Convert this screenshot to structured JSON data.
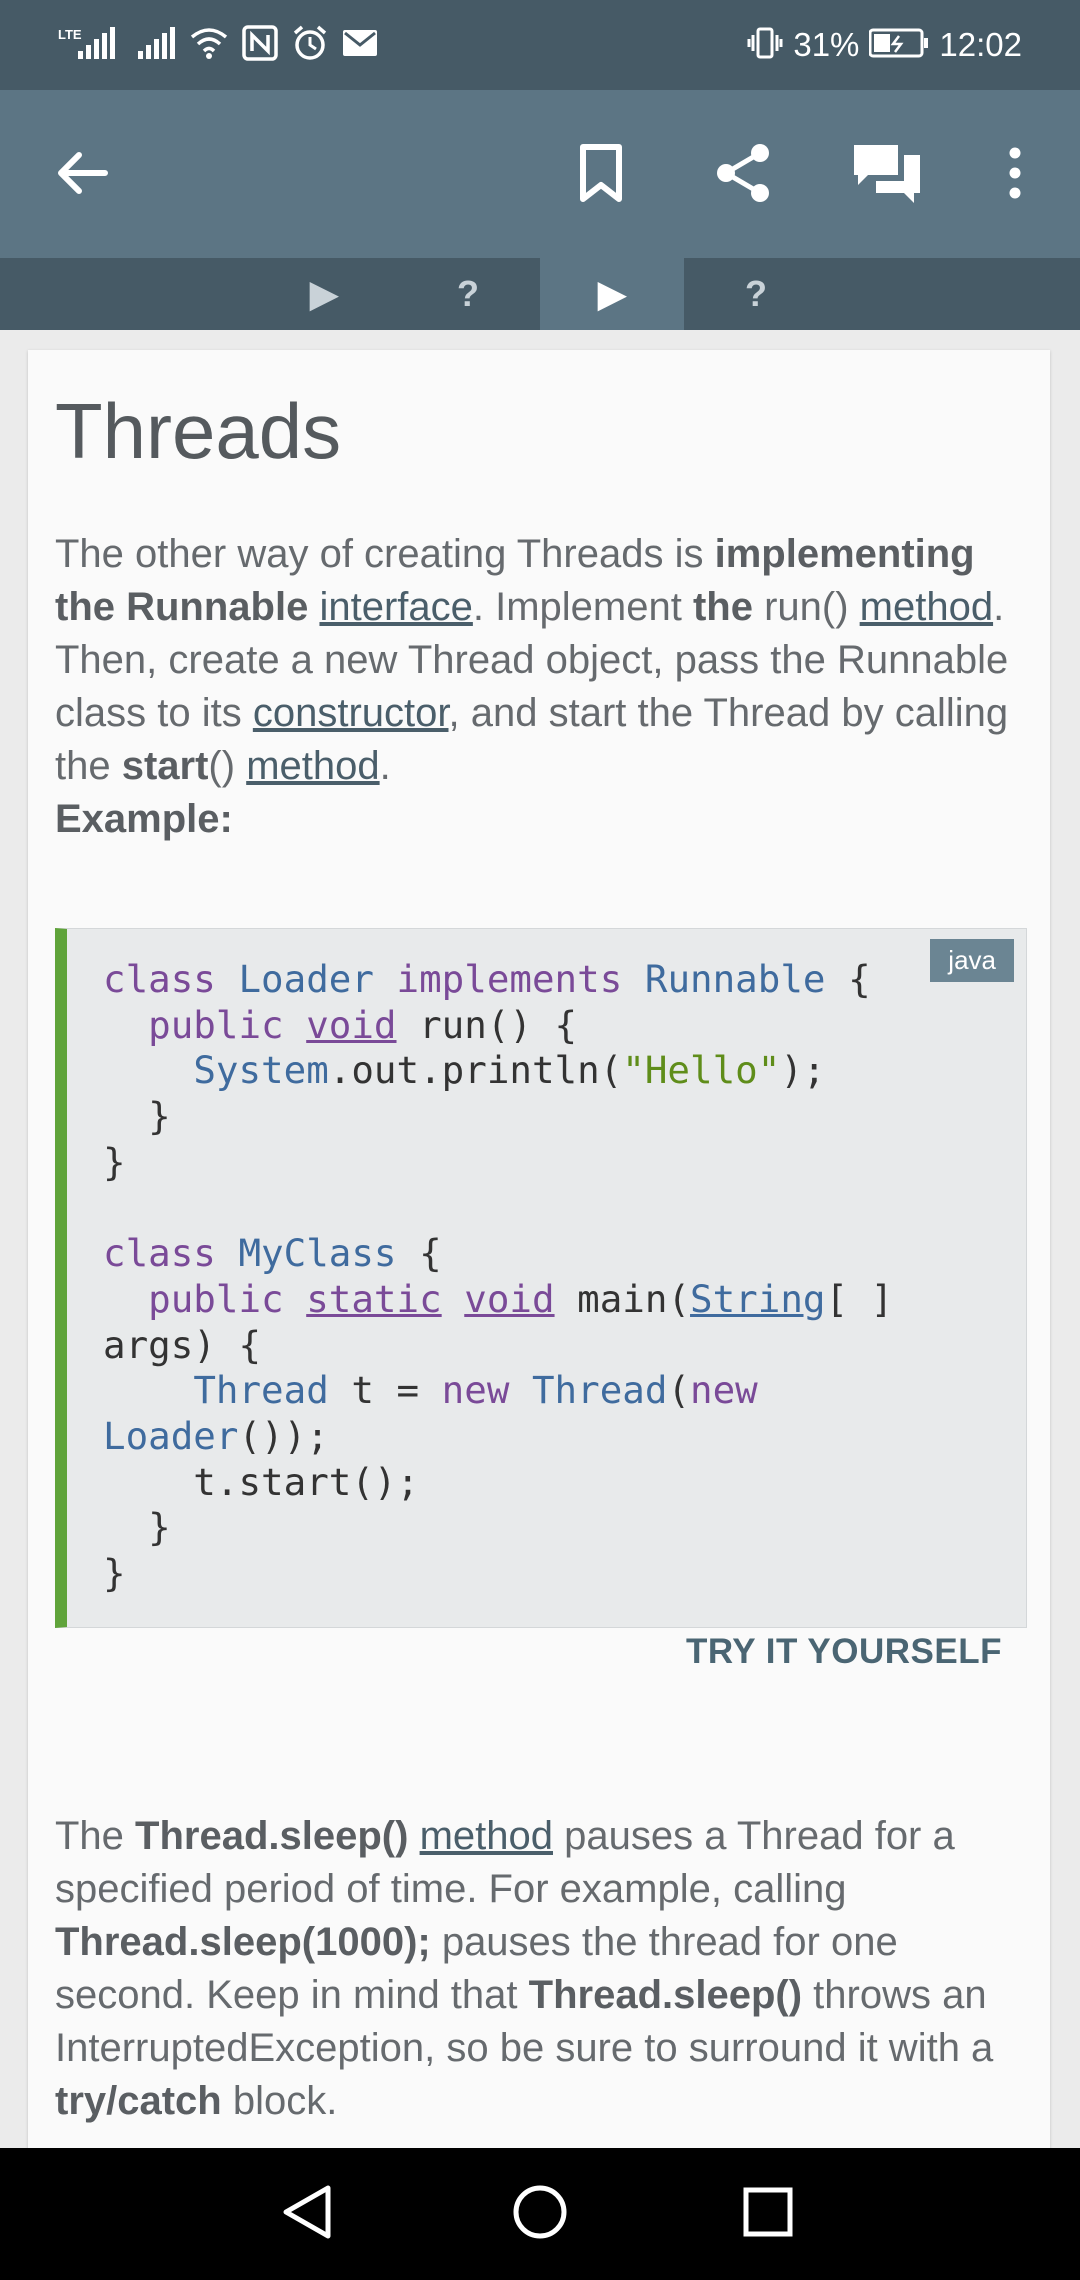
{
  "status_bar": {
    "network_label": "LTE",
    "battery_percent": "31%",
    "time": "12:02",
    "icons": [
      "lte-signal-icon",
      "signal-icon",
      "wifi-icon",
      "nfc-icon",
      "alarm-icon",
      "mail-icon",
      "vibrate-icon",
      "battery-icon"
    ]
  },
  "app_bar": {
    "icons": [
      "back-arrow-icon",
      "bookmark-icon",
      "share-icon",
      "comments-icon",
      "more-vert-icon"
    ],
    "color": "#5c7584"
  },
  "tabs": [
    {
      "label": "▶",
      "active": false
    },
    {
      "label": "?",
      "active": false
    },
    {
      "label": "▶",
      "active": true
    },
    {
      "label": "?",
      "active": false
    }
  ],
  "lesson": {
    "title": "Threads",
    "para1": {
      "t1": "The other way of creating Threads is ",
      "b1": "implementing the Runnable ",
      "l1": "interface",
      "t2": ". Implement ",
      "b2": "the",
      "t3": " run() ",
      "l2": "method",
      "t4": ". Then, create a new Thread object, pass the Runnable class to its ",
      "l3": "constructor",
      "t5": ", and start the Thread by calling the ",
      "b3": "start",
      "t6": "() ",
      "l4": "method",
      "t7": "."
    },
    "example_label": "Example:",
    "code_lang": "java",
    "code_lines": [
      [
        [
          "kw",
          "class"
        ],
        [
          "",
          ""
        ],
        [
          "ty",
          "Loader"
        ],
        [
          "",
          ""
        ],
        [
          "kw",
          "implements"
        ],
        [
          "",
          ""
        ],
        [
          "ty",
          "Runnable"
        ],
        [
          "",
          " {"
        ]
      ],
      [
        [
          "",
          "  "
        ],
        [
          "kw",
          "public"
        ],
        [
          "",
          " "
        ],
        [
          "kwu",
          "void"
        ],
        [
          "",
          " run() {"
        ]
      ],
      [
        [
          "",
          "    "
        ],
        [
          "ty",
          "System"
        ],
        [
          "",
          ".out.println("
        ],
        [
          "st",
          "\"Hello\""
        ],
        [
          "",
          ");"
        ]
      ],
      [
        [
          "",
          "  }"
        ]
      ],
      [
        [
          "",
          "}"
        ]
      ],
      [
        [
          "",
          ""
        ]
      ],
      [
        [
          "kw",
          "class"
        ],
        [
          "",
          " "
        ],
        [
          "ty",
          "MyClass"
        ],
        [
          "",
          " {"
        ]
      ],
      [
        [
          "",
          "  "
        ],
        [
          "kw",
          "public"
        ],
        [
          "",
          " "
        ],
        [
          "kwu",
          "static"
        ],
        [
          "",
          " "
        ],
        [
          "kwu",
          "void"
        ],
        [
          "",
          " main("
        ],
        [
          "tyu",
          "String"
        ],
        [
          "",
          "[ ]"
        ]
      ],
      [
        [
          "",
          "args) {"
        ]
      ],
      [
        [
          "",
          "    "
        ],
        [
          "ty",
          "Thread"
        ],
        [
          "",
          " t = "
        ],
        [
          "kw",
          "new"
        ],
        [
          "",
          " "
        ],
        [
          "ty",
          "Thread"
        ],
        [
          "",
          "("
        ],
        [
          "kw",
          "new"
        ]
      ],
      [
        [
          "ty",
          "Loader"
        ],
        [
          "",
          "());"
        ]
      ],
      [
        [
          "",
          "    t.start();"
        ]
      ],
      [
        [
          "",
          "  }"
        ]
      ],
      [
        [
          "",
          "}"
        ]
      ]
    ],
    "try_label": "TRY IT YOURSELF",
    "para2": {
      "t1": "The ",
      "b1": "Thread.sleep()",
      "t2": " ",
      "l1": "method",
      "t3": " pauses a Thread for a specified period of time. For example, calling ",
      "b2": "Thread.sleep(1000);",
      "t4": " pauses the thread for one second. Keep in mind that ",
      "b3": "Thread.sleep()",
      "t5": " throws an InterruptedException, so be sure to surround it with a ",
      "b4": "try/catch",
      "t6": " block."
    }
  },
  "nav_bar": {
    "icons": [
      "back-triangle-icon",
      "home-circle-icon",
      "recents-square-icon"
    ]
  }
}
